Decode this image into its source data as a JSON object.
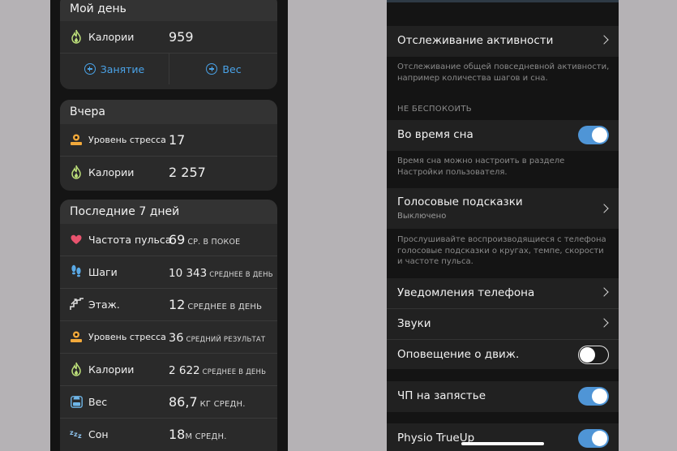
{
  "left": {
    "my_day": {
      "title": "Мой день",
      "calories_label": "Калории",
      "calories_value": "959",
      "add_activity": "Занятие",
      "add_weight": "Вес"
    },
    "yesterday": {
      "title": "Вчера",
      "rows": [
        {
          "label": "Уровень стресса",
          "value": "17",
          "icon": "stress-icon"
        },
        {
          "label": "Калории",
          "value": "2 257",
          "icon": "flame-icon"
        }
      ]
    },
    "last7": {
      "title": "Последние 7 дней",
      "rows": [
        {
          "label": "Частота пульса",
          "value": "69",
          "unit": "СР. В ПОКОЕ",
          "icon": "heart-icon"
        },
        {
          "label": "Шаги",
          "value": "10 343",
          "unit": "СРЕДНЕЕ В ДЕНЬ",
          "icon": "footprints-icon"
        },
        {
          "label": "Этаж.",
          "value": "12",
          "unit": "СРЕДНЕЕ В ДЕНЬ",
          "icon": "stairs-icon"
        },
        {
          "label": "Уровень стресса",
          "value": "36",
          "unit": "СРЕДНИЙ РЕЗУЛЬТАТ",
          "icon": "stress-icon"
        },
        {
          "label": "Калории",
          "value": "2 622",
          "unit": "СРЕДНЕЕ В ДЕНЬ",
          "icon": "flame-icon"
        },
        {
          "label": "Вес",
          "value": "86,7",
          "unit": "КГ СРЕДН.",
          "icon": "scale-icon"
        },
        {
          "label": "Сон",
          "value": "18",
          "unit": "М СРЕДН.",
          "icon": "sleep-icon"
        }
      ]
    }
  },
  "right": {
    "activity_tracking": {
      "label": "Отслеживание активности",
      "description": "Отслеживание общей повседневной активности, например количества шагов и сна."
    },
    "dnd_section_title": "НЕ БЕСПОКОИТЬ",
    "during_sleep": {
      "label": "Во время сна",
      "toggle": "on",
      "description": "Время сна можно настроить в разделе Настройки пользователя."
    },
    "voice_prompts": {
      "label": "Голосовые подсказки",
      "sublabel": "Выключено",
      "description": "Прослушивайте воспроизводящиеся с телефона голосовые подсказки о кругах, темпе, скорости и частоте пульса."
    },
    "phone_notifications": {
      "label": "Уведомления телефона"
    },
    "sounds": {
      "label": "Звуки"
    },
    "move_alert": {
      "label": "Оповещение о движ.",
      "toggle": "off"
    },
    "wrist_hr": {
      "label": "ЧП на запястье",
      "toggle": "on"
    },
    "physio_trueup": {
      "label": "Physio TrueUp",
      "toggle": "on"
    }
  },
  "colors": {
    "accent": "#4aa3e8",
    "toggle_on": "#4f95d6",
    "flame": "#bde07a",
    "stress": "#f2a93b",
    "heart": "#e8536e",
    "steps": "#5aa9e6"
  }
}
